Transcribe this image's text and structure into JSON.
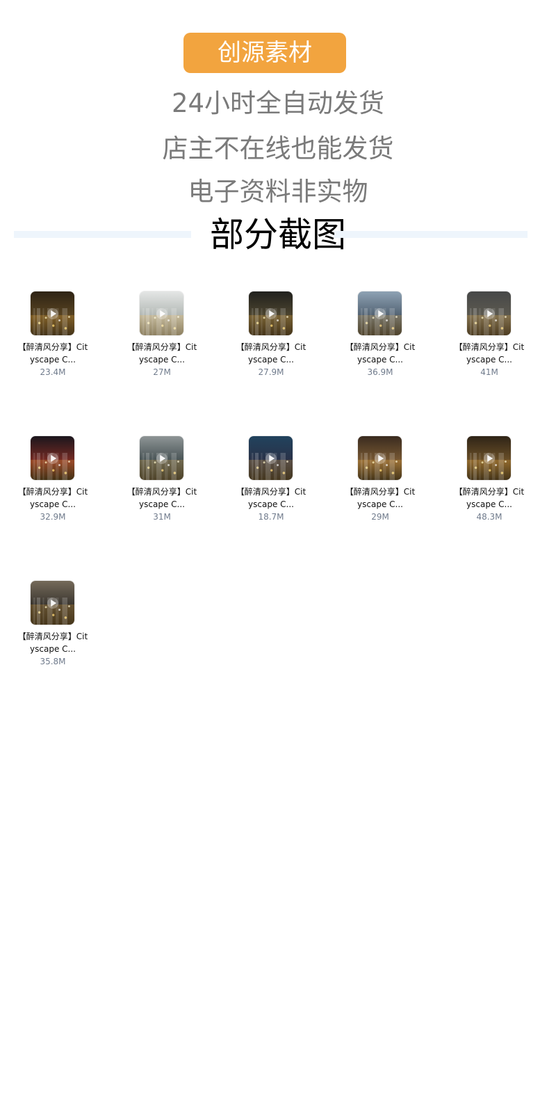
{
  "promo": {
    "brand": "创源素材",
    "lines": [
      "24小时全自动发货",
      "店主不在线也能发货",
      "电子资料非实物"
    ]
  },
  "section": {
    "title": "部分截图"
  },
  "files": [
    {
      "name_line1": "【醉清风分享】Cit",
      "name_line2": "yscape C...",
      "size": "23.4M",
      "theme": [
        "#2e2314",
        "#5a4522",
        "#101010"
      ]
    },
    {
      "name_line1": "【醉清风分享】Cit",
      "name_line2": "yscape C...",
      "size": "27M",
      "theme": [
        "#e4e6e5",
        "#b0b6b2",
        "#6d716b"
      ]
    },
    {
      "name_line1": "【醉清风分享】Cit",
      "name_line2": "yscape C...",
      "size": "27.9M",
      "theme": [
        "#20201d",
        "#4f4730",
        "#111111"
      ]
    },
    {
      "name_line1": "【醉清风分享】Cit",
      "name_line2": "yscape C...",
      "size": "36.9M",
      "theme": [
        "#8ea2b4",
        "#4f5f6f",
        "#1e2328"
      ]
    },
    {
      "name_line1": "【醉清风分享】Cit",
      "name_line2": "yscape C...",
      "size": "41M",
      "theme": [
        "#474848",
        "#5d5a50",
        "#1b1b1b"
      ]
    },
    {
      "name_line1": "【醉清风分享】Cit",
      "name_line2": "yscape C...",
      "size": "32.9M",
      "theme": [
        "#1b161d",
        "#7a2b23",
        "#0d0b0a"
      ]
    },
    {
      "name_line1": "【醉清风分享】Cit",
      "name_line2": "yscape C...",
      "size": "31M",
      "theme": [
        "#8e9596",
        "#455052",
        "#1c2224"
      ]
    },
    {
      "name_line1": "【醉清风分享】Cit",
      "name_line2": "yscape C...",
      "size": "18.7M",
      "theme": [
        "#21435e",
        "#2a3147",
        "#101317"
      ]
    },
    {
      "name_line1": "【醉清风分享】Cit",
      "name_line2": "yscape C...",
      "size": "29M",
      "theme": [
        "#3a2b1f",
        "#7b5b34",
        "#111111"
      ]
    },
    {
      "name_line1": "【醉清风分享】Cit",
      "name_line2": "yscape C...",
      "size": "48.3M",
      "theme": [
        "#2f2417",
        "#6d5128",
        "#0f0f0f"
      ]
    },
    {
      "name_line1": "【醉清风分享】Cit",
      "name_line2": "yscape C...",
      "size": "35.8M",
      "theme": [
        "#756a5a",
        "#37332d",
        "#131313"
      ]
    }
  ]
}
